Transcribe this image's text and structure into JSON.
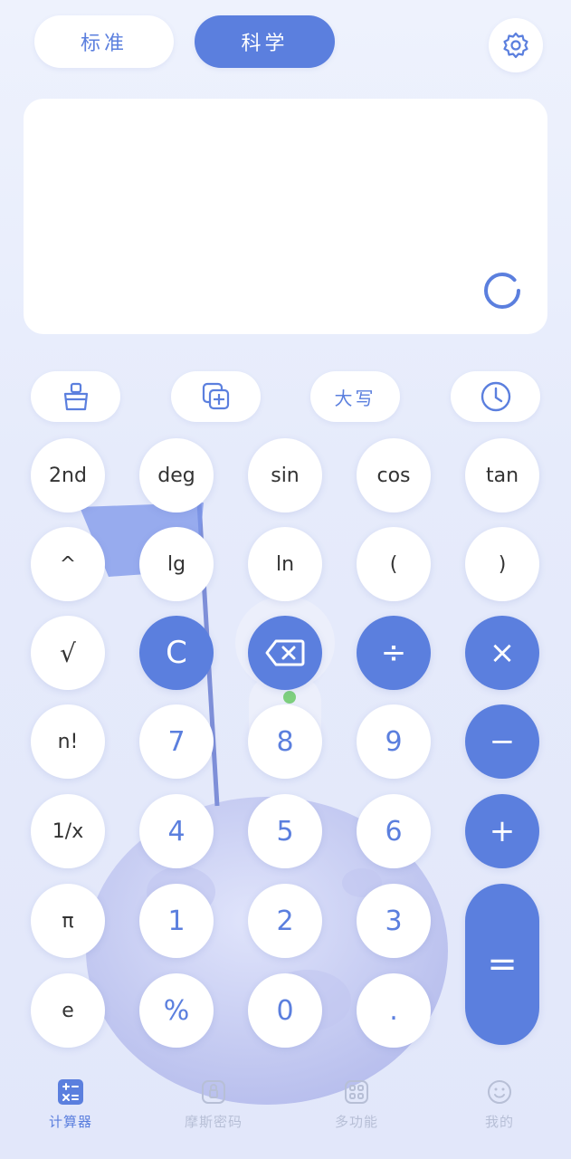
{
  "tabs": {
    "standard": "标准",
    "scientific": "科学"
  },
  "settings_icon": "gear-icon",
  "display": {
    "expression": "",
    "result": ""
  },
  "tools": {
    "clear_icon": "broom-icon",
    "copy_icon": "copy-plus-icon",
    "uppercase": "大写",
    "history_icon": "clock-icon"
  },
  "keys": {
    "second": "2nd",
    "deg": "deg",
    "sin": "sin",
    "cos": "cos",
    "tan": "tan",
    "power": "^",
    "lg": "lg",
    "ln": "ln",
    "lparen": "(",
    "rparen": ")",
    "sqrt": "√",
    "clear": "C",
    "divide": "÷",
    "multiply": "×",
    "factorial": "n!",
    "seven": "7",
    "eight": "8",
    "nine": "9",
    "minus": "−",
    "reciprocal": "1/x",
    "four": "4",
    "five": "5",
    "six": "6",
    "plus": "+",
    "pi": "π",
    "one": "1",
    "two": "2",
    "three": "3",
    "equals": "=",
    "e": "e",
    "percent": "%",
    "zero": "0",
    "dot": "."
  },
  "nav": [
    {
      "label": "计算器",
      "icon": "calculator-icon",
      "active": true
    },
    {
      "label": "摩斯密码",
      "icon": "lock-icon",
      "active": false
    },
    {
      "label": "多功能",
      "icon": "grid-icon",
      "active": false
    },
    {
      "label": "我的",
      "icon": "smiley-icon",
      "active": false
    }
  ],
  "colors": {
    "accent": "#5b7fde",
    "inactive": "#b7bfd6"
  }
}
